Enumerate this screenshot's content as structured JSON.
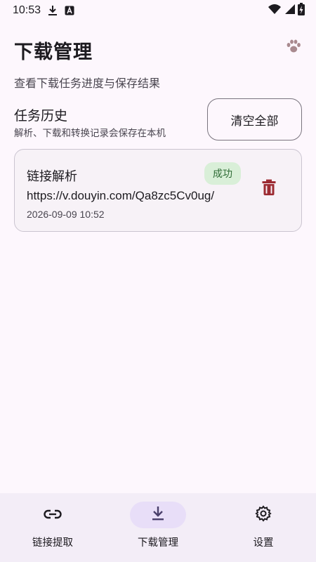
{
  "status_bar": {
    "time": "10:53",
    "icons": [
      "download-icon",
      "a-box-icon",
      "wifi-icon",
      "signal-icon",
      "battery-charging-icon"
    ]
  },
  "header": {
    "title": "下载管理",
    "subtitle": "查看下载任务进度与保存结果",
    "corner_icon": "paw-icon"
  },
  "history": {
    "title": "任务历史",
    "description": "解析、下载和转换记录会保存在本机",
    "clear_label": "清空全部"
  },
  "tasks": [
    {
      "type": "链接解析",
      "status": "成功",
      "url": "https://v.douyin.com/Qa8zc5Cv0ug/",
      "time": "2026-09-09 10:52",
      "delete_icon": "trash-icon"
    }
  ],
  "bottom_nav": {
    "items": [
      {
        "label": "链接提取",
        "icon": "link-icon",
        "active": false
      },
      {
        "label": "下载管理",
        "icon": "download-icon",
        "active": true
      },
      {
        "label": "设置",
        "icon": "gear-icon",
        "active": false
      }
    ]
  },
  "colors": {
    "background": "#fdf7fd",
    "card": "#f7f2f7",
    "success_badge_bg": "#d9efd8",
    "success_badge_text": "#2e6b35",
    "delete_icon": "#9c2b32",
    "nav_active": "#e8def8",
    "nav_background": "#f3edf7"
  }
}
